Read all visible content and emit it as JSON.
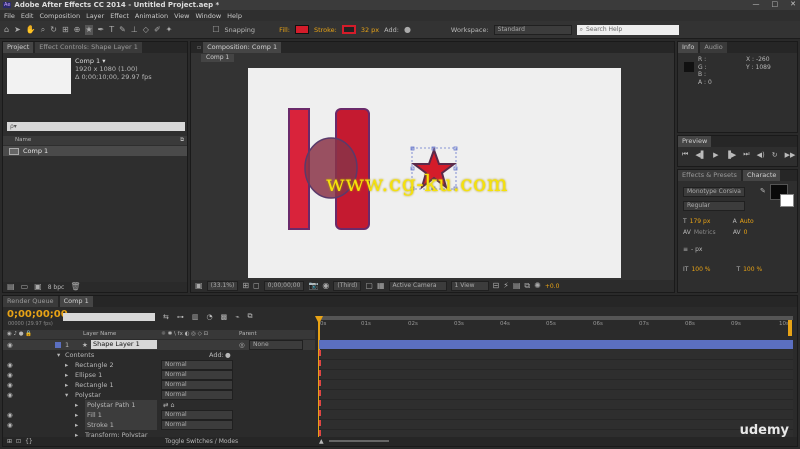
{
  "app": {
    "title": "Adobe After Effects CC 2014 - Untitled Project.aep *",
    "badge": "Ae",
    "win": [
      "—",
      "□",
      "✕"
    ]
  },
  "menu": [
    "File",
    "Edit",
    "Composition",
    "Layer",
    "Effect",
    "Animation",
    "View",
    "Window",
    "Help"
  ],
  "toolbar": {
    "snapping": "Snapping",
    "fill": "Fill:",
    "stroke": "Stroke:",
    "stroke_px": "32 px",
    "add": "Add:",
    "workspace": "Workspace:",
    "workspace_val": "Standard",
    "search": "Search Help"
  },
  "project": {
    "tab1": "Project",
    "tab2": "Effect Controls: Shape Layer 1",
    "comp_name": "Comp 1 ▾",
    "comp_size": "1920 x 1080 (1.00)",
    "comp_dur": "Δ 0;00;10;00, 29.97 fps",
    "search_ph": "ρ▾",
    "col_name": "Name",
    "item": "Comp 1",
    "bpc": "8 bpc"
  },
  "composition": {
    "tab": "Composition: Comp 1",
    "breadcrumb": "Comp 1",
    "zoom": "(33.1%)",
    "time": "0;00;00;00",
    "res": "(Third)",
    "camera": "Active Camera",
    "views": "1 View",
    "exposure": "+0.0"
  },
  "watermark": "www.cg-ku.com",
  "info": {
    "tab1": "Info",
    "tab2": "Audio",
    "r": "R :",
    "g": "G :",
    "b": "B :",
    "a": "A : 0",
    "x": "X : -260",
    "y": "Y : 1089"
  },
  "preview": {
    "tab": "Preview"
  },
  "character": {
    "tab1": "Effects & Presets",
    "tab2": "Characte",
    "font": "Monotype Corsiva",
    "style": "Regular",
    "size": "179 px",
    "leading": "Auto",
    "tracking": "0",
    "metrics": "Metrics",
    "kern": "0",
    "px": "- px",
    "scale_v": "100 %",
    "scale_h": "100 %"
  },
  "timeline": {
    "tab1": "Render Queue",
    "tab2": "Comp 1",
    "time": "0;00;00;00",
    "fps": "00000 (29.97 fps)",
    "col_layer": "Layer Name",
    "col_parent": "Parent",
    "toggle": "Toggle Switches / Modes",
    "ruler": [
      "0s",
      "01s",
      "02s",
      "03s",
      "04s",
      "05s",
      "06s",
      "07s",
      "08s",
      "09s",
      "10s"
    ],
    "layers": [
      {
        "num": "1",
        "name": "Shape Layer 1",
        "mode": "",
        "parent": "None",
        "indent": 0
      },
      {
        "num": "",
        "name": "Contents",
        "mode": "Add:",
        "parent": "",
        "indent": 1
      },
      {
        "num": "",
        "name": "Rectangle 2",
        "mode": "Normal",
        "parent": "",
        "indent": 2
      },
      {
        "num": "",
        "name": "Ellipse 1",
        "mode": "Normal",
        "parent": "",
        "indent": 2
      },
      {
        "num": "",
        "name": "Rectangle 1",
        "mode": "Normal",
        "parent": "",
        "indent": 2
      },
      {
        "num": "",
        "name": "Polystar",
        "mode": "Normal",
        "parent": "",
        "indent": 2
      },
      {
        "num": "",
        "name": "Polystar Path 1",
        "mode": "",
        "parent": "",
        "indent": 3
      },
      {
        "num": "",
        "name": "Fill 1",
        "mode": "Normal",
        "parent": "",
        "indent": 3
      },
      {
        "num": "",
        "name": "Stroke 1",
        "mode": "Normal",
        "parent": "",
        "indent": 3
      },
      {
        "num": "",
        "name": "Transform: Polystar",
        "mode": "",
        "parent": "",
        "indent": 3
      }
    ]
  },
  "udemy": "udemy",
  "colors": {
    "accent": "#e8a316",
    "fill": "#d41c2a",
    "layerbar": "#5b6fc0",
    "canvas": "#efefef",
    "shape": "#c9263a"
  }
}
